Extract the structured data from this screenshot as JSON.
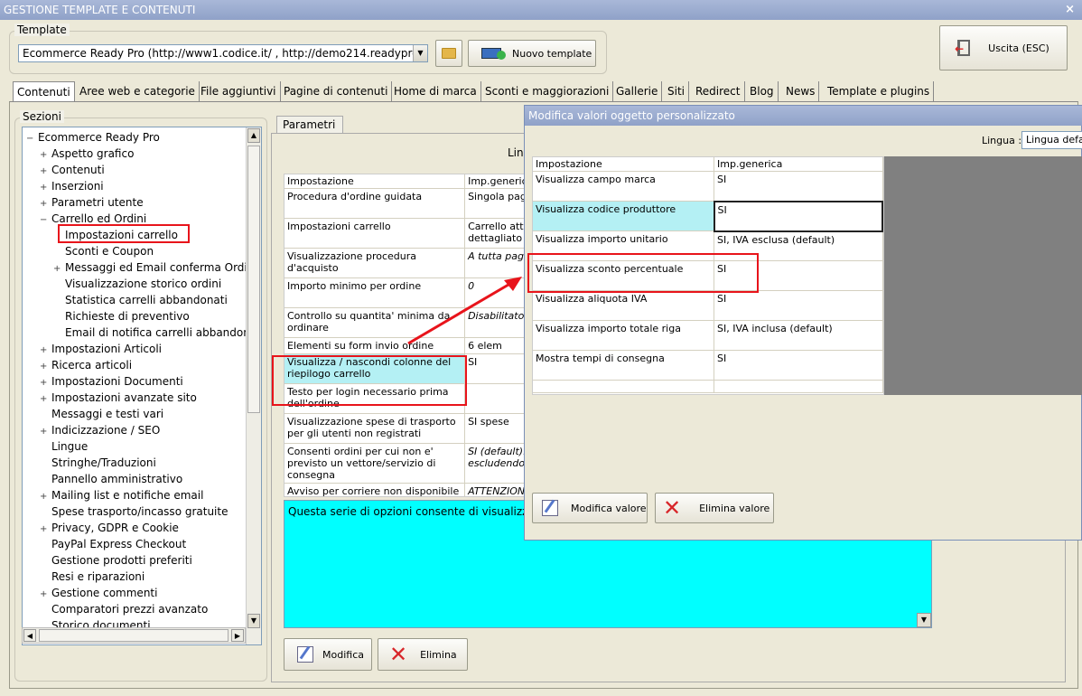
{
  "window": {
    "title": "GESTIONE TEMPLATE E CONTENUTI",
    "close": "×"
  },
  "template": {
    "label": "Template",
    "value": "Ecommerce Ready Pro (http://www1.codice.it/ , http://demo214.readyprod",
    "new_button": "Nuovo template"
  },
  "exit_button": "Uscita (ESC)",
  "tabs": [
    "Contenuti",
    "Aree web e categorie",
    "File aggiuntivi",
    "Pagine di contenuti",
    "Home di marca",
    "Sconti e maggiorazioni",
    "Gallerie",
    "Siti",
    "Redirect",
    "Blog",
    "News",
    "Template e plugins"
  ],
  "sections": {
    "label": "Sezioni",
    "items": [
      {
        "text": "Ecommerce Ready Pro",
        "sign": "−"
      },
      {
        "text": "Aspetto grafico",
        "sign": "+"
      },
      {
        "text": "Contenuti",
        "sign": "+"
      },
      {
        "text": "Inserzioni",
        "sign": "+"
      },
      {
        "text": "Parametri utente",
        "sign": "+"
      },
      {
        "text": "Carrello ed Ordini",
        "sign": "−"
      },
      {
        "text": "Impostazioni carrello",
        "sign": ""
      },
      {
        "text": "Sconti e Coupon",
        "sign": ""
      },
      {
        "text": "Messaggi ed Email conferma Ordin",
        "sign": "+"
      },
      {
        "text": "Visualizzazione storico ordini",
        "sign": ""
      },
      {
        "text": "Statistica carrelli abbandonati",
        "sign": ""
      },
      {
        "text": "Richieste di preventivo",
        "sign": ""
      },
      {
        "text": "Email di notifica carrelli abbandona",
        "sign": ""
      },
      {
        "text": "Impostazioni Articoli",
        "sign": "+"
      },
      {
        "text": "Ricerca articoli",
        "sign": "+"
      },
      {
        "text": "Impostazioni Documenti",
        "sign": "+"
      },
      {
        "text": "Impostazioni avanzate sito",
        "sign": "+"
      },
      {
        "text": "Messaggi e testi vari",
        "sign": ""
      },
      {
        "text": "Indicizzazione / SEO",
        "sign": "+"
      },
      {
        "text": "Lingue",
        "sign": ""
      },
      {
        "text": "Stringhe/Traduzioni",
        "sign": ""
      },
      {
        "text": "Pannello amministrativo",
        "sign": ""
      },
      {
        "text": "Mailing list e notifiche email",
        "sign": "+"
      },
      {
        "text": "Spese trasporto/incasso gratuite",
        "sign": ""
      },
      {
        "text": "Privacy, GDPR e Cookie",
        "sign": "+"
      },
      {
        "text": "PayPal Express Checkout",
        "sign": ""
      },
      {
        "text": "Gestione prodotti preferiti",
        "sign": ""
      },
      {
        "text": "Resi e riparazioni",
        "sign": ""
      },
      {
        "text": "Gestione commenti",
        "sign": "+"
      },
      {
        "text": "Comparatori prezzi avanzato",
        "sign": ""
      },
      {
        "text": "Storico documenti",
        "sign": ""
      }
    ]
  },
  "params": {
    "tab": "Parametri",
    "lingua_partial": "Lin",
    "headers": [
      "Impostazione",
      "Imp.generica"
    ],
    "rows": [
      [
        "Procedura d'ordine guidata",
        "Singola pagin"
      ],
      [
        "Impostazioni carrello",
        "Carrello attiv dettagliato (v"
      ],
      [
        "Visualizzazione procedura d'acquisto",
        "A tutta pagin"
      ],
      [
        "Importo minimo per ordine",
        "0"
      ],
      [
        "Controllo su quantita' minima da ordinare",
        "Disabilitato"
      ],
      [
        "Elementi su form invio ordine",
        "6 elem"
      ],
      [
        "Visualizza / nascondi colonne del riepilogo carrello",
        "SI"
      ],
      [
        "Testo per login necessario prima dell'ordine",
        ""
      ],
      [
        "Visualizzazione spese di trasporto per gli utenti non registrati",
        "SI spese"
      ],
      [
        "Consenti ordini per cui non e' previsto un vettore/servizio di consegna",
        "SI (default): escludendo p"
      ],
      [
        "Avviso per corriere non disponibile",
        "ATTENZIONE"
      ]
    ],
    "description": "Questa serie di opzioni consente di visualizzare articolo, ...)",
    "modify": "Modifica",
    "delete": "Elimina"
  },
  "dialog": {
    "title": "Modifica valori oggetto personalizzato",
    "lingua_label": "Lingua :",
    "lingua_value": "Lingua defaul",
    "headers": [
      "Impostazione",
      "Imp.generica"
    ],
    "rows": [
      [
        "Visualizza campo marca",
        "SI"
      ],
      [
        "Visualizza codice produttore",
        "SI"
      ],
      [
        "Visualizza importo unitario",
        "SI, IVA esclusa (default)"
      ],
      [
        "Visualizza sconto percentuale",
        "SI"
      ],
      [
        "Visualizza aliquota IVA",
        "SI"
      ],
      [
        "Visualizza importo totale riga",
        "SI, IVA inclusa (default)"
      ],
      [
        "Mostra tempi di consegna",
        "SI"
      ]
    ],
    "modify": "Modifica valore",
    "delete": "Elimina valore"
  },
  "colors": {
    "selection": "#b4f0f4",
    "description_bg": "#00ffff",
    "annotation": "#e8141b",
    "title_bar": "#8fa1c8"
  }
}
